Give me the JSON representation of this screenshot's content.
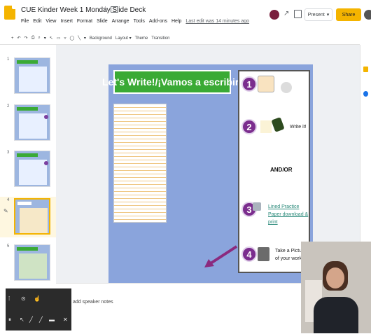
{
  "doc": {
    "title": "CUE Kinder Week 1 Monday Slide Deck",
    "star": "☆",
    "menu": [
      "File",
      "Edit",
      "View",
      "Insert",
      "Format",
      "Slide",
      "Arrange",
      "Tools",
      "Add-ons",
      "Help"
    ],
    "last_edit": "Last edit was 14 minutes ago"
  },
  "topbar": {
    "trend_icon": "↗",
    "present_label": "Present",
    "present_caret": "▾",
    "share_label": "Share"
  },
  "toolbar": {
    "items": [
      "↶",
      "↷",
      "⎙",
      "⌕",
      "▾",
      "↖",
      "▭",
      "▿",
      "◯",
      "╲",
      "▾",
      "+"
    ],
    "background": "Background",
    "layout": "Layout ▾",
    "theme": "Theme",
    "transition": "Transition"
  },
  "filmstrip": {
    "slides": [
      "1",
      "2",
      "3",
      "4",
      "5"
    ],
    "pencil_icon": "✎"
  },
  "slide": {
    "title": "Let's Write!/¡Vamos a escribir!",
    "steps": [
      "1",
      "2",
      "3",
      "4"
    ],
    "write_it": "Write it!",
    "andor": "AND/OR",
    "lined_paper": "Lined Practice Paper download & print",
    "take_picture_1": "Take a Picture",
    "take_picture_2": "of your work"
  },
  "notes": {
    "placeholder": "add speaker notes"
  },
  "annotation": {
    "tools": [
      "⁞",
      "⊙",
      "☝",
      "⏸",
      "↖",
      "╱",
      "╱",
      "▬",
      "✕"
    ]
  },
  "colors": {
    "accent_yellow": "#f4b400",
    "slide_blue": "#8aa4dc",
    "title_green": "#3aaa35",
    "step_purple": "#7b2d8e"
  }
}
